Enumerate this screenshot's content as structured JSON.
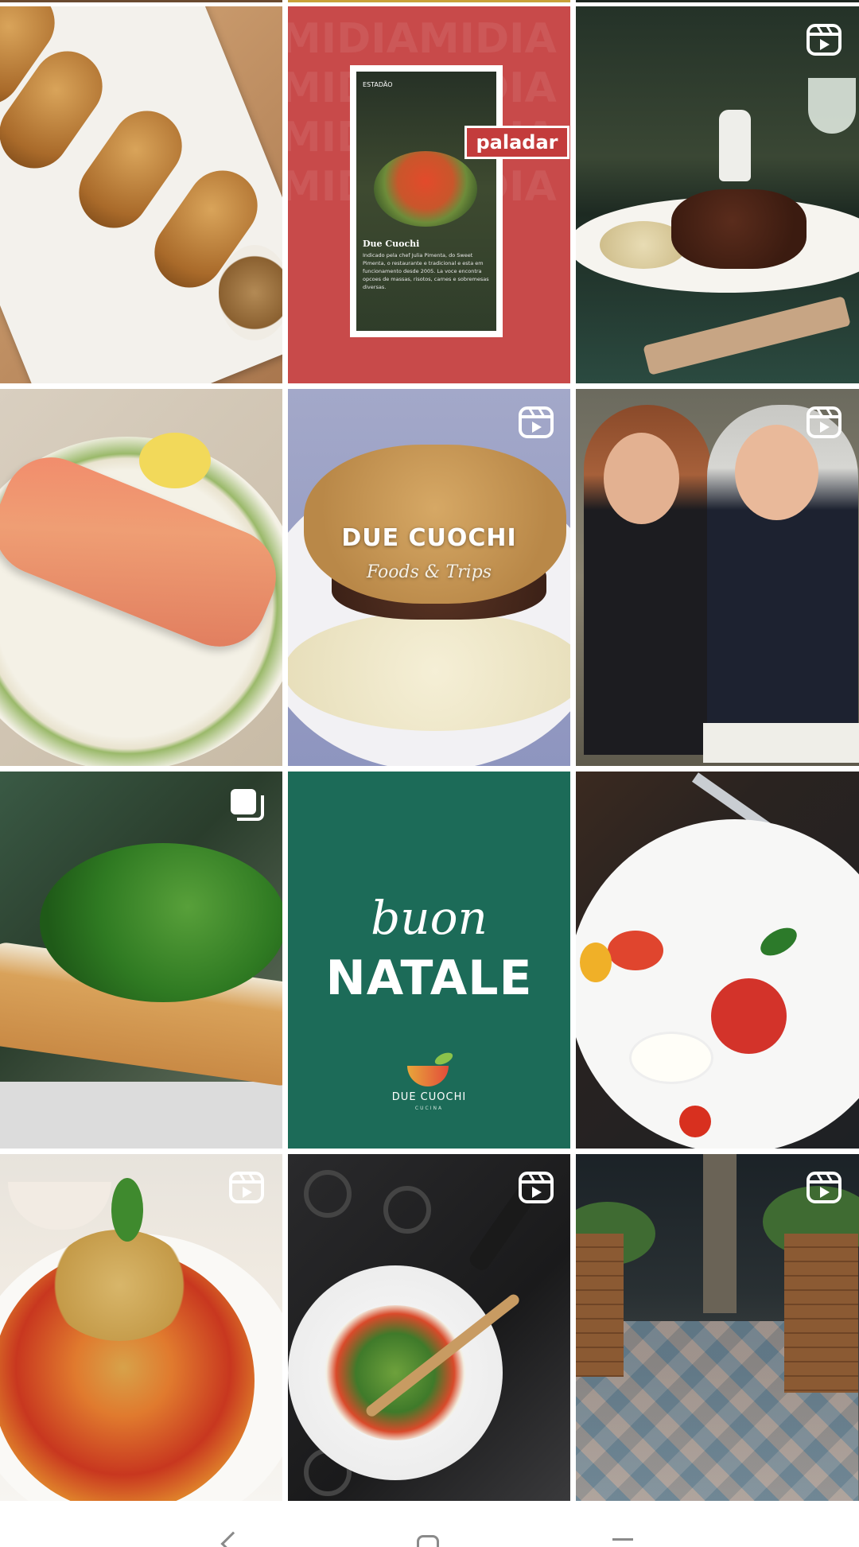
{
  "app": "Instagram profile grid",
  "colors": {
    "background": "#ffffff",
    "icon": "#ffffff",
    "nav_icon": "#8a8a8a",
    "tile_red": "#c84a4a",
    "tile_green": "#1c6b58"
  },
  "posts": [
    {
      "name": "post-croquettes",
      "type": "photo",
      "badge": null
    },
    {
      "name": "post-paladar-feature",
      "type": "photo",
      "badge": null,
      "text": {
        "background_text": "MIDIAMIDIAMIDIAMIDIAMIDIAMIDIAMIDIAMIDIA",
        "source": "ESTADÃO",
        "logo": "paladar",
        "title": "Due Cuochi",
        "description": "Indicado pela chef Julia Pimenta, do Sweet Pimenta, o restaurante e tradicional e esta em funcionamento desde 2005. La voce encontra opcoes de massas, risotos, carnes e sobremesas diversas."
      }
    },
    {
      "name": "post-lamb-risotto",
      "type": "reel",
      "badge": "reel-icon"
    },
    {
      "name": "post-salmon-toast",
      "type": "photo",
      "badge": null
    },
    {
      "name": "post-due-cuochi-foods-trips",
      "type": "reel",
      "badge": "reel-icon",
      "text": {
        "title": "DUE CUOCHI",
        "subtitle": "Foods & Trips"
      }
    },
    {
      "name": "post-two-women-toast",
      "type": "reel",
      "badge": "reel-icon"
    },
    {
      "name": "post-bruschetta",
      "type": "carousel",
      "badge": "carousel-icon"
    },
    {
      "name": "post-buon-natale",
      "type": "photo",
      "badge": null,
      "text": {
        "line1": "buon",
        "line2": "NATALE",
        "brand": "DUE CUOCHI",
        "brand_sub": "CUCINA"
      }
    },
    {
      "name": "post-caprese",
      "type": "photo",
      "badge": null
    },
    {
      "name": "post-pasta",
      "type": "reel",
      "badge": "reel-icon"
    },
    {
      "name": "post-pan-cooking",
      "type": "reel",
      "badge": "reel-icon"
    },
    {
      "name": "post-terrace",
      "type": "reel",
      "badge": "reel-icon"
    }
  ],
  "nav": {
    "back_icon": "back-icon",
    "home_icon": "home-icon",
    "recents_icon": "recents-icon"
  }
}
